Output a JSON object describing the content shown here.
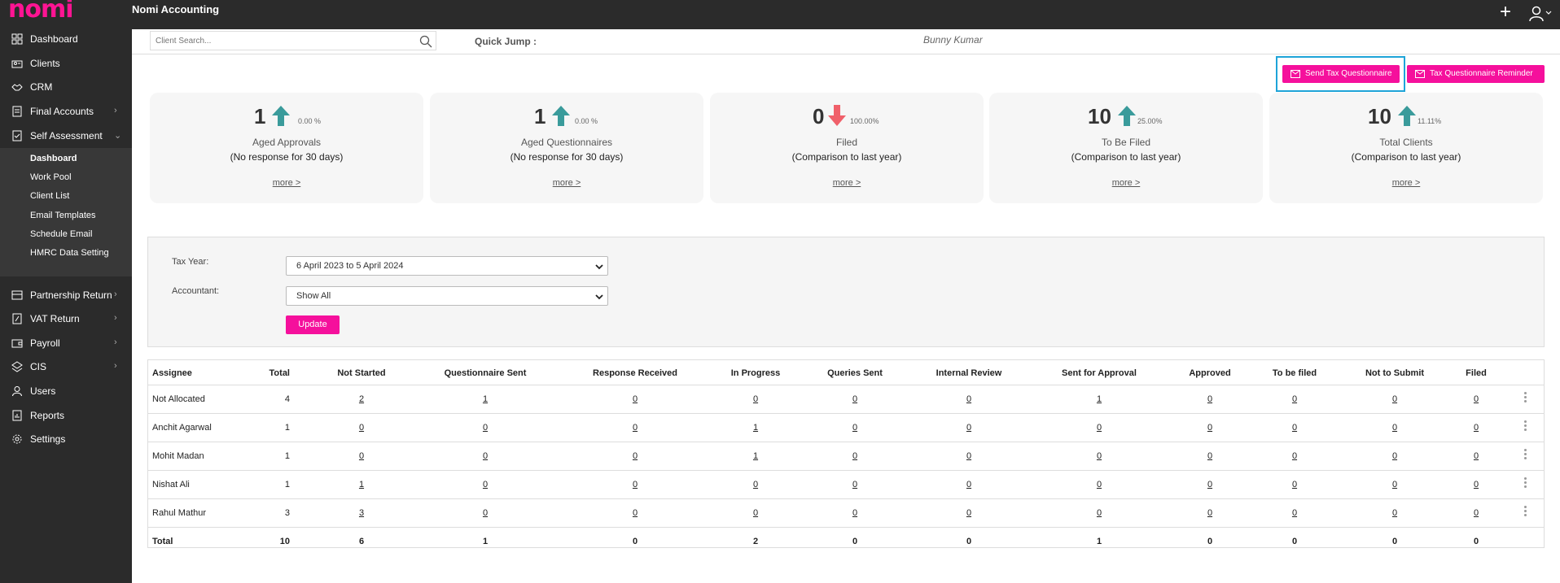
{
  "app": {
    "logo": "nomi",
    "title": "Nomi Accounting"
  },
  "sidebar": {
    "items": [
      {
        "label": "Dashboard",
        "icon": "grid-icon"
      },
      {
        "label": "Clients",
        "icon": "clients-icon"
      },
      {
        "label": "CRM",
        "icon": "handshake-icon"
      },
      {
        "label": "Final Accounts",
        "icon": "document-icon"
      },
      {
        "label": "Self Assessment",
        "icon": "self-assessment-icon"
      },
      {
        "label": "Partnership Return",
        "icon": "partnership-icon"
      },
      {
        "label": "VAT Return",
        "icon": "vat-icon"
      },
      {
        "label": "Payroll",
        "icon": "wallet-icon"
      },
      {
        "label": "CIS",
        "icon": "cis-icon"
      },
      {
        "label": "Users",
        "icon": "user-icon"
      },
      {
        "label": "Reports",
        "icon": "report-icon"
      },
      {
        "label": "Settings",
        "icon": "gear-icon"
      }
    ],
    "submenu": [
      "Dashboard",
      "Work Pool",
      "Client List",
      "Email Templates",
      "Schedule Email",
      "HMRC Data Setting"
    ]
  },
  "search": {
    "placeholder": "Client Search..."
  },
  "quick_jump": "Quick Jump :",
  "user_name": "Bunny Kumar",
  "actions": {
    "send_questionnaire": "Send Tax Questionnaire",
    "reminder": "Tax Questionnaire Reminder"
  },
  "cards": [
    {
      "value": "1",
      "trend": "up",
      "pct": "0.00 %",
      "title": "Aged Approvals",
      "subtitle": "(No response for 30 days)",
      "more": "more >"
    },
    {
      "value": "1",
      "trend": "up",
      "pct": "0.00 %",
      "title": "Aged Questionnaires",
      "subtitle": "(No response for 30 days)",
      "more": "more >"
    },
    {
      "value": "0",
      "trend": "down",
      "pct": "100.00%",
      "title": "Filed",
      "subtitle": "(Comparison to last year)",
      "more": "more >"
    },
    {
      "value": "10",
      "trend": "up",
      "pct": "25.00%",
      "title": "To Be Filed",
      "subtitle": "(Comparison to last year)",
      "more": "more >"
    },
    {
      "value": "10",
      "trend": "up",
      "pct": "11.11%",
      "title": "Total Clients",
      "subtitle": "(Comparison to last year)",
      "more": "more >"
    }
  ],
  "filters": {
    "tax_year_label": "Tax Year:",
    "tax_year_value": "6 April 2023 to 5 April 2024",
    "accountant_label": "Accountant:",
    "accountant_value": "Show All",
    "update_label": "Update"
  },
  "table": {
    "headers": [
      "Assignee",
      "Total",
      "Not Started",
      "Questionnaire Sent",
      "Response Received",
      "In Progress",
      "Queries Sent",
      "Internal Review",
      "Sent for Approval",
      "Approved",
      "To be filed",
      "Not to Submit",
      "Filed"
    ],
    "rows": [
      [
        "Not Allocated",
        "4",
        "2",
        "1",
        "0",
        "0",
        "0",
        "0",
        "1",
        "0",
        "0",
        "0",
        "0"
      ],
      [
        "Anchit Agarwal",
        "1",
        "0",
        "0",
        "0",
        "1",
        "0",
        "0",
        "0",
        "0",
        "0",
        "0",
        "0"
      ],
      [
        "Mohit Madan",
        "1",
        "0",
        "0",
        "0",
        "1",
        "0",
        "0",
        "0",
        "0",
        "0",
        "0",
        "0"
      ],
      [
        "Nishat Ali",
        "1",
        "1",
        "0",
        "0",
        "0",
        "0",
        "0",
        "0",
        "0",
        "0",
        "0",
        "0"
      ],
      [
        "Rahul Mathur",
        "3",
        "3",
        "0",
        "0",
        "0",
        "0",
        "0",
        "0",
        "0",
        "0",
        "0",
        "0"
      ]
    ],
    "total": [
      "Total",
      "10",
      "6",
      "1",
      "0",
      "2",
      "0",
      "0",
      "1",
      "0",
      "0",
      "0",
      "0"
    ]
  },
  "colors": {
    "accent": "#f5109c",
    "sidebar": "#2b2b2b",
    "up": "#3a9b9b",
    "down": "#f0606a",
    "focus": "#1ea4d8"
  }
}
